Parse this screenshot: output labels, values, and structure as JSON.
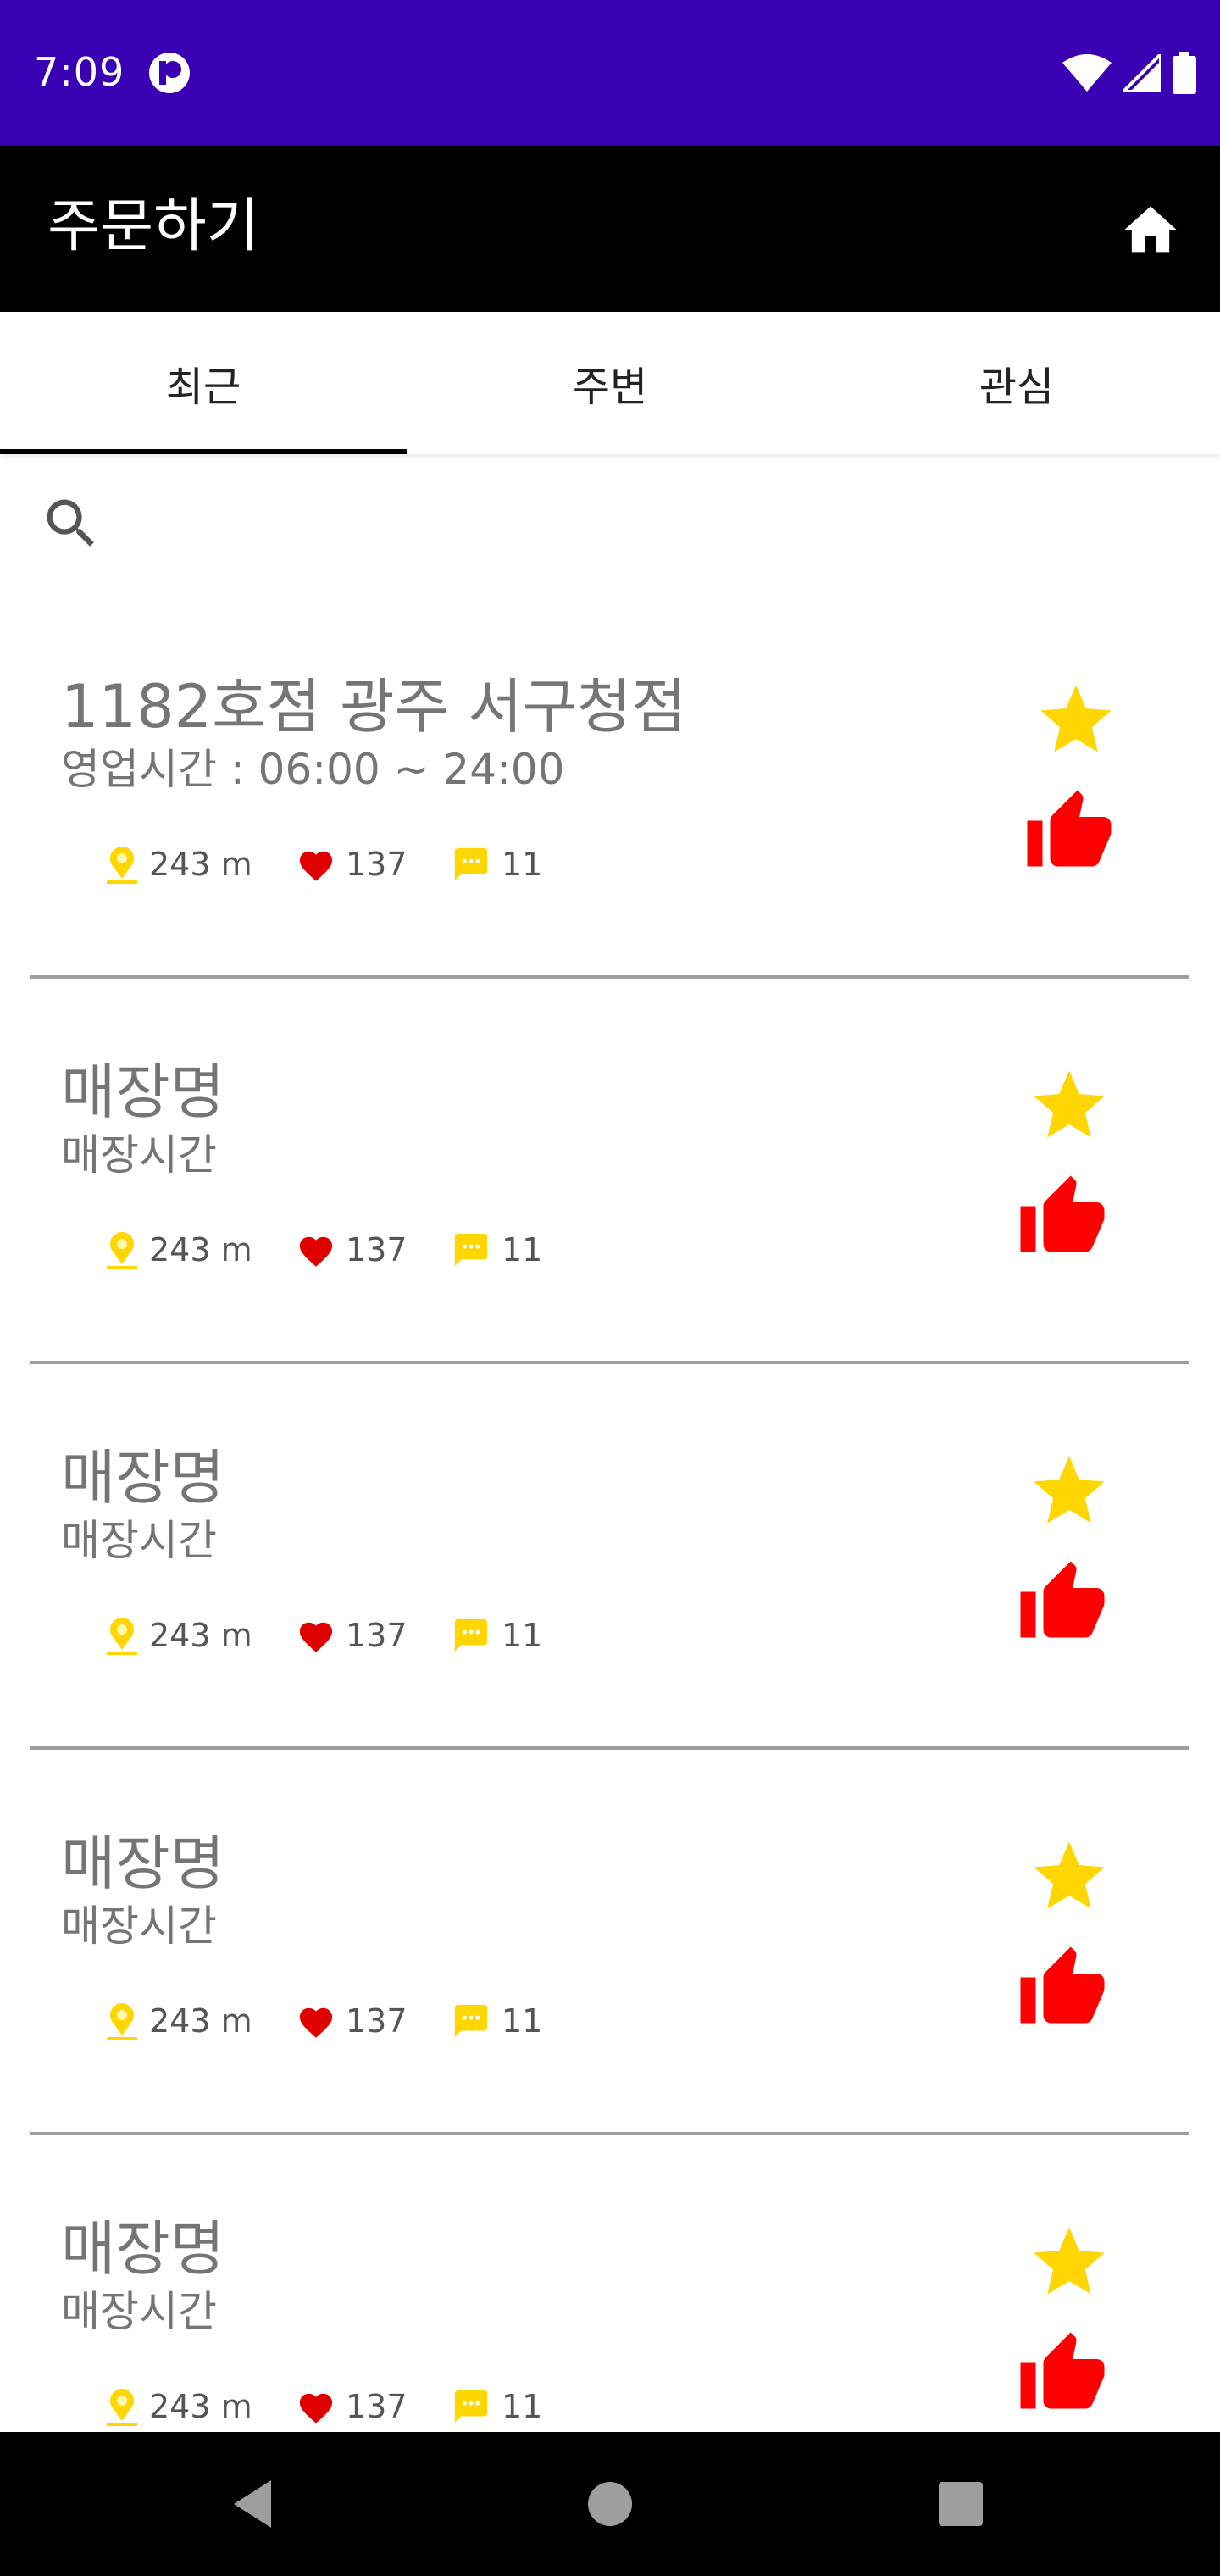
{
  "status_bar": {
    "time": "7:09",
    "app_icon": "p-circle-icon",
    "icons": [
      "wifi-icon",
      "cellular-signal-icon",
      "battery-icon"
    ],
    "background": "#3a00b4"
  },
  "app_bar": {
    "title": "주문하기",
    "home_icon": "home-icon"
  },
  "tabs": [
    {
      "label": "최근",
      "selected": true
    },
    {
      "label": "주변",
      "selected": false
    },
    {
      "label": "관심",
      "selected": false
    }
  ],
  "search": {
    "icon": "search-icon",
    "value": "",
    "placeholder": ""
  },
  "stores": [
    {
      "name": "1182호점 광주 서구청점",
      "hours": "영업시간 : 06:00 ~ 24:00",
      "distance": "243 m",
      "likes": "137",
      "comments": "11"
    },
    {
      "name": "매장명",
      "hours": "매장시간",
      "distance": "243 m",
      "likes": "137",
      "comments": "11"
    },
    {
      "name": "매장명",
      "hours": "매장시간",
      "distance": "243 m",
      "likes": "137",
      "comments": "11"
    },
    {
      "name": "매장명",
      "hours": "매장시간",
      "distance": "243 m",
      "likes": "137",
      "comments": "11"
    },
    {
      "name": "매장명",
      "hours": "매장시간",
      "distance": "243 m",
      "likes": "137",
      "comments": "11"
    }
  ],
  "colors": {
    "accent_yellow": "#ffd600",
    "thumb_red": "#ff0000",
    "heart_red": "#e00000",
    "text_gray": "#757575"
  },
  "nav_bar": {
    "icons": [
      "back-icon",
      "home-circle-icon",
      "recents-icon"
    ]
  }
}
